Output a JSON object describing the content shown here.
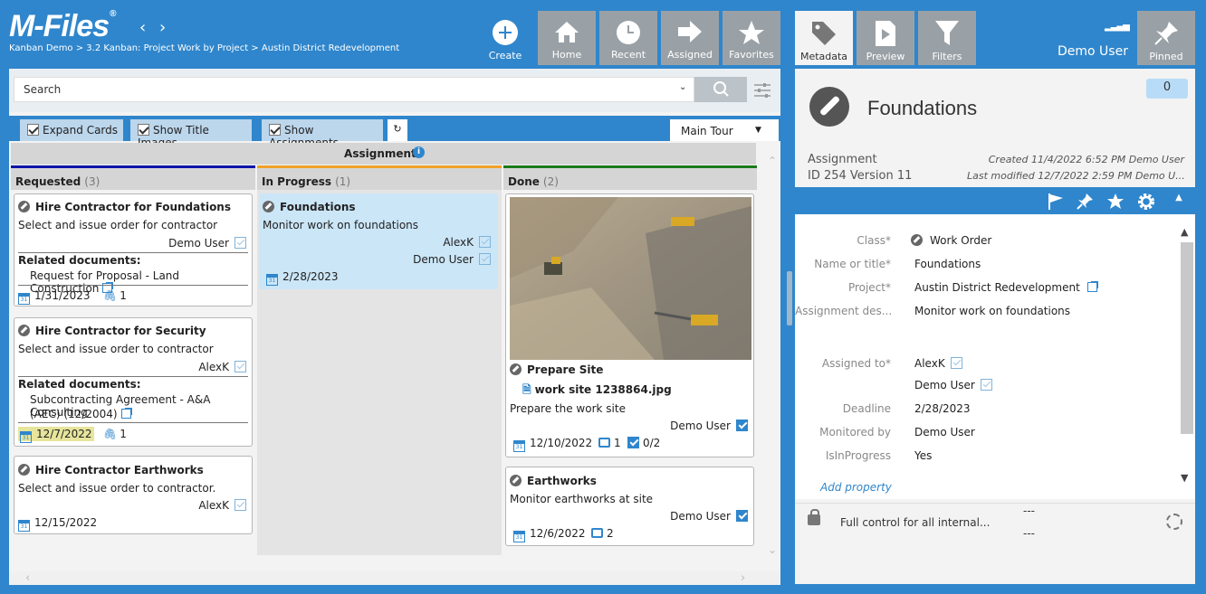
{
  "app": {
    "logo": "M-Files",
    "breadcrumb": "Kanban Demo > 3.2 Kanban: Project Work by Project > Austin District Redevelopment"
  },
  "nav": {
    "create": "Create",
    "tabs": [
      {
        "label": "Home",
        "icon": "home-icon"
      },
      {
        "label": "Recent",
        "icon": "clock-icon"
      },
      {
        "label": "Assigned",
        "icon": "arrow-right-icon"
      },
      {
        "label": "Favorites",
        "icon": "star-icon"
      }
    ]
  },
  "search": {
    "placeholder": "Search"
  },
  "options": {
    "expand_cards": "Expand Cards",
    "show_title_images": "Show Title Images",
    "show_assignments": "Show Assignments",
    "tour": "Main Tour"
  },
  "board": {
    "title": "Assignments",
    "columns": [
      {
        "name": "Requested",
        "count": "(3)",
        "color": "#0c14a8"
      },
      {
        "name": "In Progress",
        "count": "(1)",
        "color": "#f0a22a"
      },
      {
        "name": "Done",
        "count": "(2)",
        "color": "#1a7a1a"
      }
    ],
    "requested": [
      {
        "title": "Hire Contractor for Foundations",
        "desc": "Select and issue order for contractor",
        "user": "Demo User",
        "related_label": "Related documents:",
        "doc": "Request for Proposal - Land Construction",
        "date": "1/31/2023",
        "attach": "1"
      },
      {
        "title": "Hire Contractor for Security",
        "desc": "Select and issue order to contractor",
        "user": "AlexK",
        "related_label": "Related documents:",
        "doc1": "Subcontracting Agreement - A&A Consulting",
        "doc2": "(AEC) (12/2004)",
        "date": "12/7/2022",
        "attach": "1"
      },
      {
        "title": "Hire Contractor Earthworks",
        "desc": "Select and issue order to contractor.",
        "user": "AlexK",
        "date": "12/15/2022"
      }
    ],
    "inprogress": [
      {
        "title": "Foundations",
        "desc": "Monitor work on foundations",
        "user1": "AlexK",
        "user2": "Demo User",
        "date": "2/28/2023"
      }
    ],
    "done": [
      {
        "title": "Prepare Site",
        "file": "work site 1238864.jpg",
        "desc": "Prepare the work site",
        "user": "Demo User",
        "date": "12/10/2022",
        "comments": "1",
        "tasks": "0/2"
      },
      {
        "title": "Earthworks",
        "desc": "Monitor earthworks at site",
        "user": "Demo User",
        "date": "12/6/2022",
        "comments": "2"
      }
    ]
  },
  "right": {
    "tabs": [
      {
        "label": "Metadata",
        "icon": "tag-icon"
      },
      {
        "label": "Preview",
        "icon": "preview-icon"
      },
      {
        "label": "Filters",
        "icon": "filter-icon"
      }
    ],
    "user": "Demo User",
    "pinned": "Pinned",
    "title": "Foundations",
    "comment_count": "0",
    "type": "Assignment",
    "id_version": "ID 254  Version 11",
    "created": "Created 11/4/2022 6:52 PM Demo User",
    "modified": "Last modified 12/7/2022 2:59 PM Demo U...",
    "props": {
      "class_label": "Class*",
      "class_value": "Work Order",
      "name_label": "Name or title*",
      "name_value": "Foundations",
      "project_label": "Project*",
      "project_value": "Austin District Redevelopment",
      "desc_label": "Assignment des...",
      "desc_value": "Monitor work on foundations",
      "assigned_label": "Assigned to*",
      "assigned_1": "AlexK",
      "assigned_2": "Demo User",
      "deadline_label": "Deadline",
      "deadline_value": "2/28/2023",
      "monitored_label": "Monitored by",
      "monitored_value": "Demo User",
      "inprogress_label": "IsInProgress",
      "inprogress_value": "Yes"
    },
    "add_property": "Add property",
    "permissions": "Full control for all internal...",
    "dash": "---"
  }
}
